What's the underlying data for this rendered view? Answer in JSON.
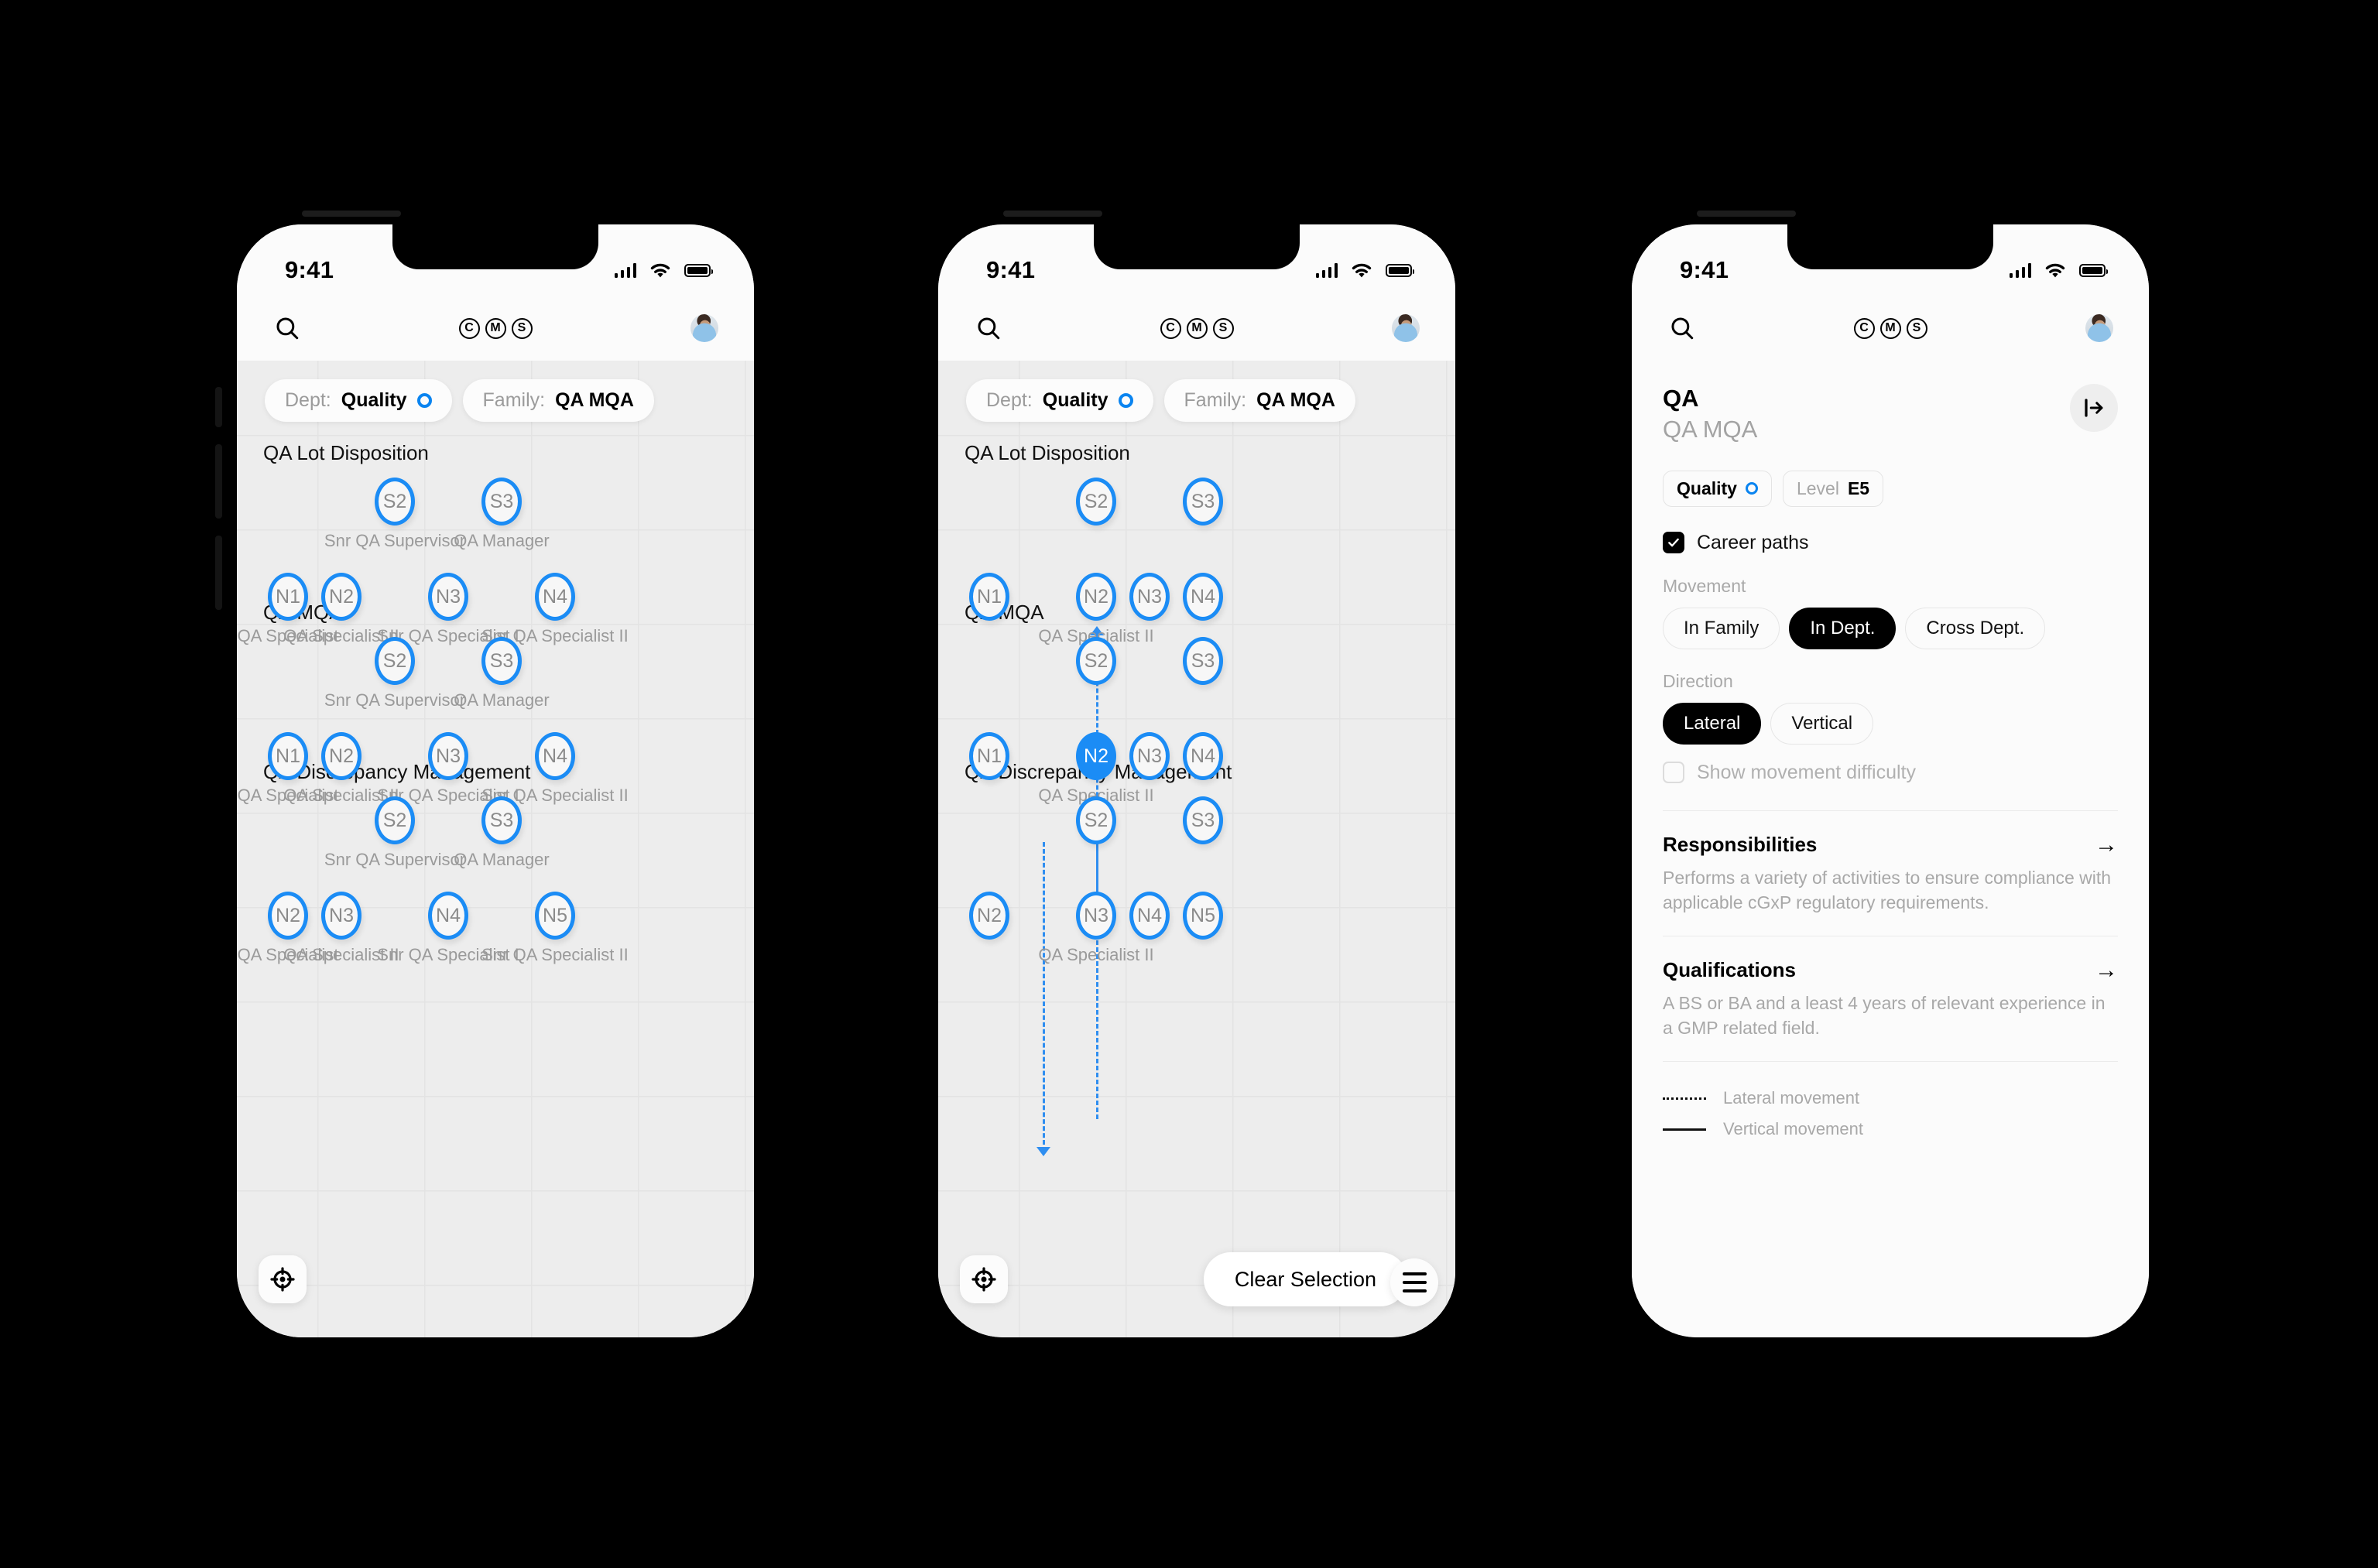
{
  "status_bar": {
    "time": "9:41",
    "signal_icon": "cellular-bars-icon",
    "wifi_icon": "wifi-icon",
    "battery_icon": "battery-icon"
  },
  "app_bar": {
    "search_icon": "search-icon",
    "logo_letters": [
      "C",
      "M",
      "S"
    ],
    "avatar_icon": "user-avatar"
  },
  "filters": {
    "dept": {
      "key": "Dept:",
      "value": "Quality",
      "indicator": "blue-ring-icon"
    },
    "family": {
      "key": "Family:",
      "value": "QA MQA"
    }
  },
  "sections": [
    {
      "title": "QA Lot Disposition"
    },
    {
      "title": "QA MQA"
    },
    {
      "title": "QA Discrepancy Management"
    }
  ],
  "nodes": {
    "s2": {
      "code": "S2",
      "label": "Snr QA Supervisor"
    },
    "s3": {
      "code": "S3",
      "label": "QA Manager"
    },
    "n1": {
      "code": "N1",
      "label": "QA Specialist"
    },
    "n2": {
      "code": "N2",
      "label": "QA Specialist II"
    },
    "n3": {
      "code": "N3",
      "label": "Snr QA Specialist I"
    },
    "n4": {
      "code": "N4",
      "label": "Snr QA Specialist II"
    },
    "n5": {
      "code": "N5",
      "label": ""
    },
    "row3_n2": {
      "code": "N2",
      "label": "QA Specialist"
    },
    "row3_n3": {
      "code": "N3",
      "label": "QA Specialist II"
    },
    "row3_n4": {
      "code": "N4",
      "label": "Snr QA Specialist I"
    },
    "row3_n5": {
      "code": "N5",
      "label": "Snr QA Specialist II"
    }
  },
  "canvas_controls": {
    "recenter_icon": "recenter-target-icon",
    "clear_selection_label": "Clear Selection",
    "menu_icon": "hamburger-menu-icon"
  },
  "detail": {
    "title": "QA",
    "subtitle": "QA MQA",
    "collapse_icon": "collapse-panel-icon",
    "chips": [
      {
        "label": "Quality",
        "indicator": "blue-ring-icon"
      },
      {
        "key": "Level",
        "value": "E5"
      }
    ],
    "career_paths": {
      "label": "Career paths",
      "checked": true
    },
    "movement": {
      "label": "Movement",
      "options": [
        "In Family",
        "In Dept.",
        "Cross Dept."
      ],
      "selected": "In Dept."
    },
    "direction": {
      "label": "Direction",
      "options": [
        "Lateral",
        "Vertical"
      ],
      "selected": "Lateral"
    },
    "show_difficulty": {
      "label": "Show movement difficulty",
      "checked": false
    },
    "responsibilities": {
      "heading": "Responsibilities",
      "arrow_icon": "arrow-right-icon",
      "body": "Performs a variety of activities to ensure compliance with applicable cGxP regulatory requirements."
    },
    "qualifications": {
      "heading": "Qualifications",
      "arrow_icon": "arrow-right-icon",
      "body": "A BS or BA and a least 4 years of relevant experience in a GMP related field."
    },
    "legend": [
      {
        "style": "dotted",
        "label": "Lateral movement"
      },
      {
        "style": "solid",
        "label": "Vertical movement"
      }
    ]
  },
  "colors": {
    "accent": "#1b8cf5",
    "canvas": "#ededed",
    "surface": "#fbfbfb",
    "ink": "#000000",
    "muted": "#a8a8a8"
  }
}
